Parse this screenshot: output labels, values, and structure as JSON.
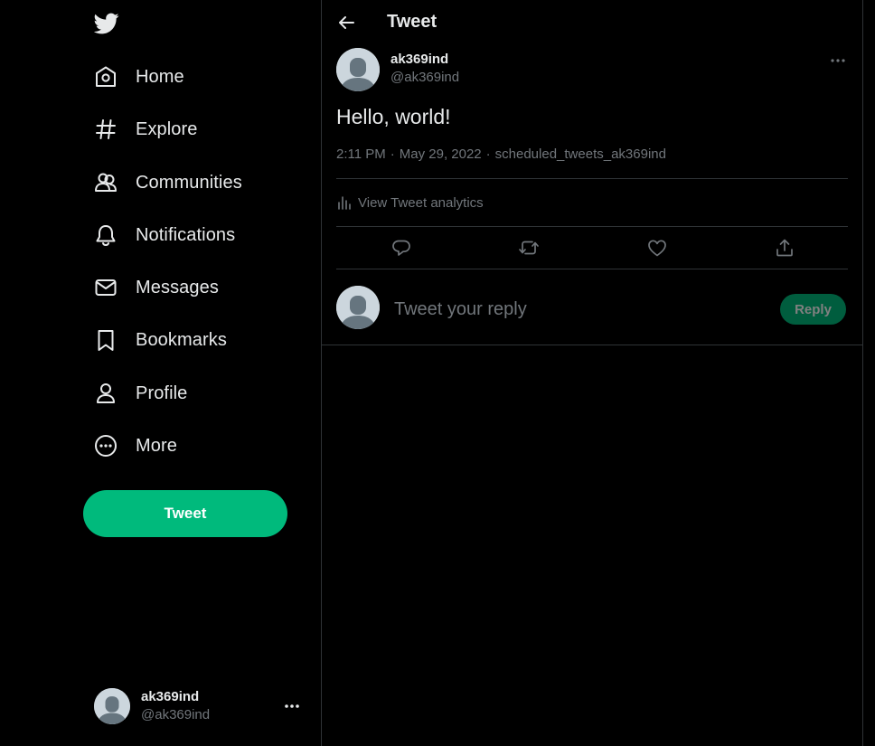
{
  "colors": {
    "accent": "#00ba7c",
    "background": "#000000",
    "text": "#e7e9ea",
    "muted": "#71767b",
    "border": "#2f3336"
  },
  "sidebar": {
    "logo_icon": "twitter-bird-icon",
    "nav": [
      {
        "label": "Home",
        "icon": "home-icon"
      },
      {
        "label": "Explore",
        "icon": "hashtag-icon"
      },
      {
        "label": "Communities",
        "icon": "communities-icon"
      },
      {
        "label": "Notifications",
        "icon": "bell-icon"
      },
      {
        "label": "Messages",
        "icon": "envelope-icon"
      },
      {
        "label": "Bookmarks",
        "icon": "bookmark-icon"
      },
      {
        "label": "Profile",
        "icon": "person-icon"
      },
      {
        "label": "More",
        "icon": "more-circle-icon"
      }
    ],
    "tweet_button": "Tweet",
    "account": {
      "name": "ak369ind",
      "handle": "@ak369ind"
    }
  },
  "header": {
    "title": "Tweet"
  },
  "tweet": {
    "author_name": "ak369ind",
    "author_handle": "@ak369ind",
    "text": "Hello, world!",
    "time": "2:11 PM",
    "date": "May 29, 2022",
    "source": "scheduled_tweets_ak369ind",
    "separator": "·",
    "analytics_label": "View Tweet analytics",
    "actions": [
      "reply-icon",
      "retweet-icon",
      "like-icon",
      "share-icon"
    ]
  },
  "reply": {
    "placeholder": "Tweet your reply",
    "button": "Reply"
  }
}
